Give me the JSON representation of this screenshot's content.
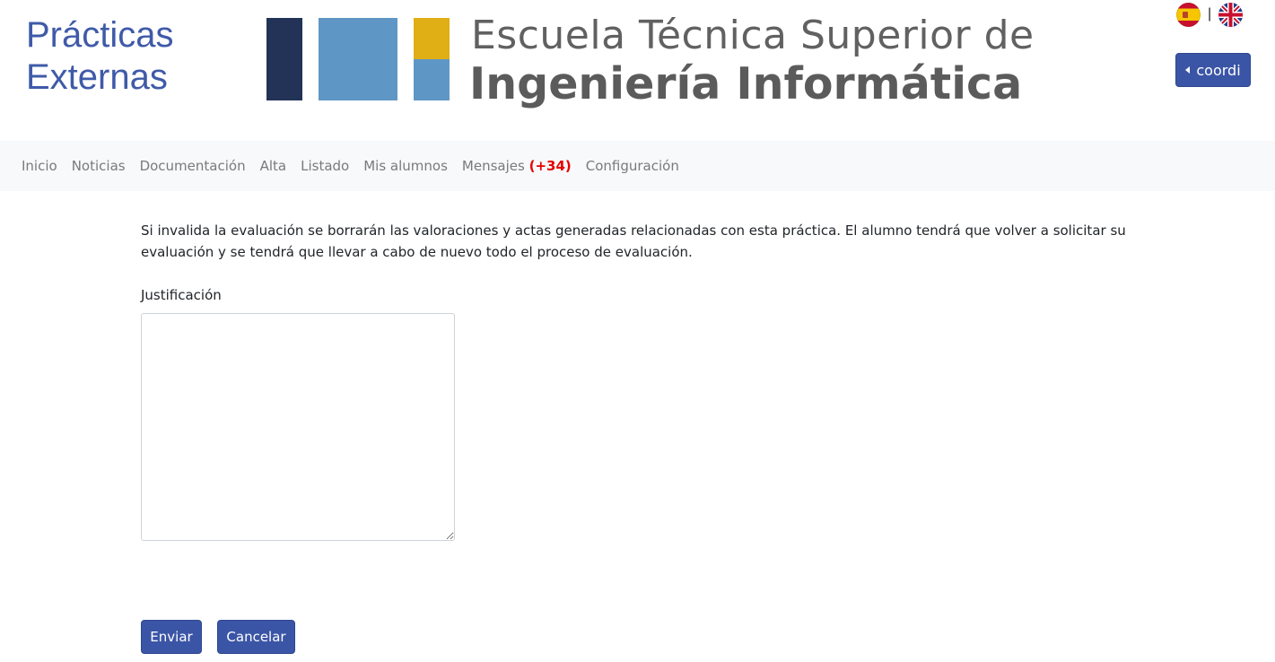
{
  "header": {
    "site_title_line1": "Prácticas",
    "site_title_line2": "Externas",
    "logo_line1": "Escuela Técnica Superior de",
    "logo_line2": "Ingeniería Informática",
    "language_separator": "|",
    "user_button_label": "coordi"
  },
  "nav": {
    "items": [
      {
        "label": "Inicio"
      },
      {
        "label": "Noticias"
      },
      {
        "label": "Documentación"
      },
      {
        "label": "Alta"
      },
      {
        "label": "Listado"
      },
      {
        "label": "Mis alumnos"
      },
      {
        "label": "Mensajes",
        "badge": "(+34)"
      },
      {
        "label": "Configuración"
      }
    ]
  },
  "form": {
    "warning_text": "Si invalida la evaluación se borrarán las valoraciones y actas generadas relacionadas con esta práctica. El alumno tendrá que volver a solicitar su evaluación y se tendrá que llevar a cabo de nuevo todo el proceso de evaluación.",
    "justification_label": "Justificación",
    "justification_value": "",
    "submit_label": "Enviar",
    "cancel_label": "Cancelar"
  },
  "colors": {
    "brand_blue": "#3b55a6",
    "title_blue": "#3f5aa8",
    "badge_red": "#e60000",
    "logo_navy": "#223357",
    "logo_lightblue": "#5e97c5",
    "logo_gold": "#e0ae15"
  },
  "icons": {
    "flag_es": "spain-flag-icon",
    "flag_en": "uk-flag-icon",
    "user_caret": "caret-left-icon"
  }
}
